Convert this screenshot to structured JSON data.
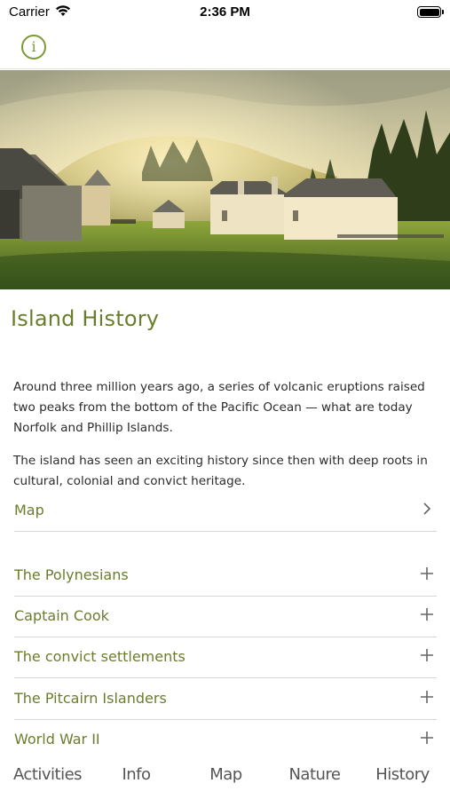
{
  "status_bar": {
    "carrier": "Carrier",
    "time": "2:36 PM"
  },
  "nav": {
    "info_icon": "info-circle-icon",
    "accent_color": "#7c9a34"
  },
  "page": {
    "title": "Island History",
    "paragraphs": [
      "Around three million years ago, a series of volcanic eruptions raised two peaks from the bottom of the Pacific Ocean — what are today Norfolk and Phillip Islands.",
      "The island has seen an exciting history since then with deep roots in cultural, colonial and convict heritage."
    ]
  },
  "map_link": {
    "label": "Map",
    "icon": "chevron-right-icon"
  },
  "sections": [
    {
      "label": "The Polynesians",
      "icon": "plus-icon"
    },
    {
      "label": "Captain Cook",
      "icon": "plus-icon"
    },
    {
      "label": "The convict settlements",
      "icon": "plus-icon"
    },
    {
      "label": "The Pitcairn Islanders",
      "icon": "plus-icon"
    },
    {
      "label": "World War II",
      "icon": "plus-icon"
    }
  ],
  "tabs": [
    {
      "label": "Activities"
    },
    {
      "label": "Info"
    },
    {
      "label": "Map"
    },
    {
      "label": "Nature"
    },
    {
      "label": "History"
    }
  ],
  "colors": {
    "title_green": "#6a7d2d",
    "divider": "#d6d6d6"
  }
}
